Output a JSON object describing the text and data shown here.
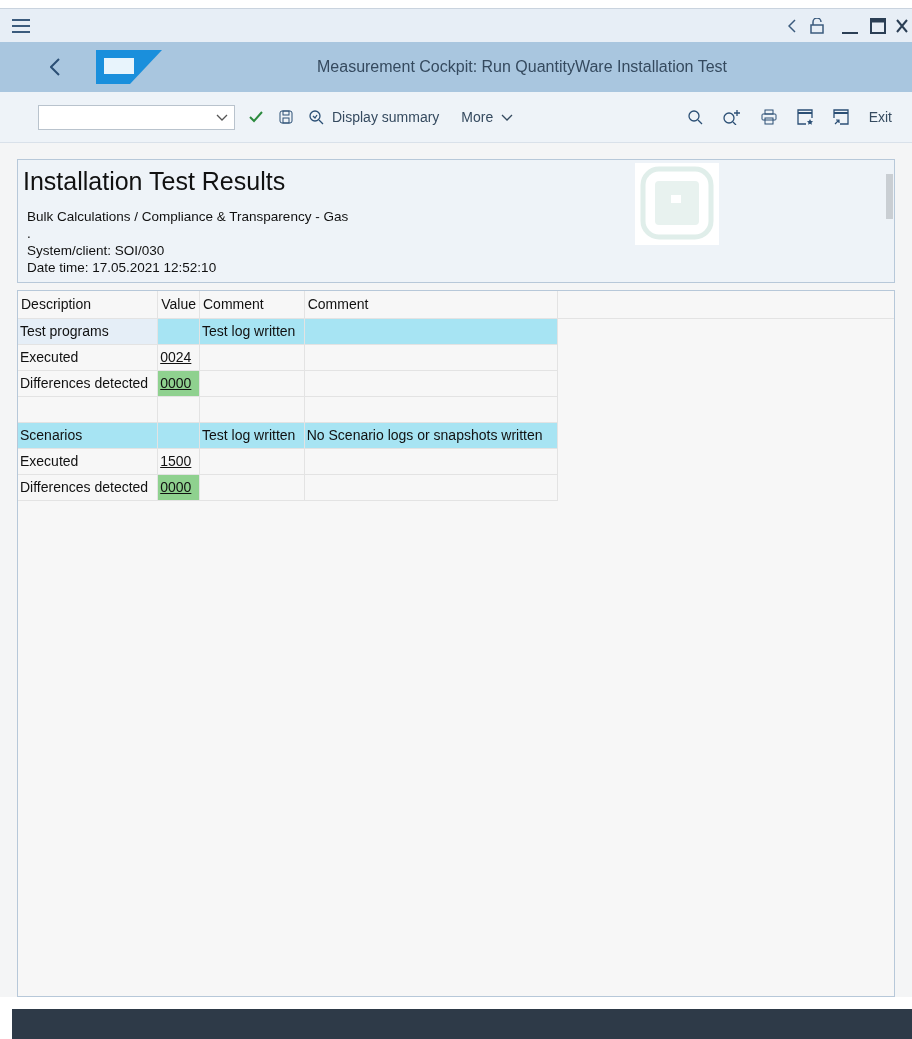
{
  "window": {
    "title": "Measurement Cockpit: Run QuantityWare Installation Test"
  },
  "toolbar": {
    "buttons": [
      {
        "kind": "icon"
      },
      {
        "kind": "icon"
      },
      {
        "kind": "text",
        "label": "Display summary"
      },
      {
        "kind": "menu",
        "label": "More"
      }
    ],
    "right_buttons": [
      {
        "kind": "icon"
      },
      {
        "kind": "icon"
      },
      {
        "kind": "icon"
      },
      {
        "kind": "icon"
      },
      {
        "kind": "icon"
      },
      {
        "kind": "text",
        "label": "Exit"
      }
    ]
  },
  "header": {
    "title": "Installation Test Results",
    "lines": [
      "Bulk Calculations / Compliance & Transparency - Gas",
      ".",
      "System/client: SOI/030",
      "Date time: 17.05.2021 12:52:10"
    ]
  },
  "table": {
    "columns": [
      "Description",
      "Value",
      "Comment",
      "Comment"
    ],
    "rows": [
      {
        "cells": [
          {
            "text": "Test programs",
            "color": "#e5eef7"
          },
          {
            "text": "",
            "color": "#a7e4f3"
          },
          {
            "text": "Test log written",
            "color": "#a7e4f3"
          },
          {
            "text": "",
            "color": "#a7e4f3"
          }
        ]
      },
      {
        "cells": [
          {
            "text": "Executed"
          },
          {
            "text": "0024",
            "link": true
          },
          {
            "text": ""
          },
          {
            "text": ""
          }
        ]
      },
      {
        "cells": [
          {
            "text": "Differences detected"
          },
          {
            "text": "0000",
            "link": true,
            "color": "#8fd18f"
          },
          {
            "text": ""
          },
          {
            "text": ""
          }
        ]
      },
      {
        "cells": [
          {
            "text": ""
          },
          {
            "text": ""
          },
          {
            "text": ""
          },
          {
            "text": ""
          }
        ]
      },
      {
        "cells": [
          {
            "text": "Scenarios",
            "color": "#a7e4f3"
          },
          {
            "text": "",
            "color": "#a7e4f3"
          },
          {
            "text": "Test log written",
            "color": "#a7e4f3"
          },
          {
            "text": "No Scenario logs or snapshots written",
            "color": "#a7e4f3"
          }
        ]
      },
      {
        "cells": [
          {
            "text": "Executed"
          },
          {
            "text": "1500",
            "link": true
          },
          {
            "text": ""
          },
          {
            "text": ""
          }
        ]
      },
      {
        "cells": [
          {
            "text": "Differences detected"
          },
          {
            "text": "0000",
            "link": true,
            "color": "#8fd18f"
          },
          {
            "text": ""
          },
          {
            "text": ""
          }
        ]
      }
    ]
  }
}
